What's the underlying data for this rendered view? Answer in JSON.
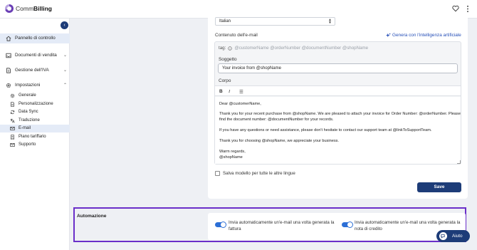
{
  "app": {
    "name_light": "Comm",
    "name_bold": "Billing"
  },
  "sidebar": {
    "collapse_glyph": "‹",
    "items": [
      {
        "label": "Pannello di controllo",
        "icon": "home-icon",
        "active": true
      },
      {
        "label": "Documenti di vendita",
        "icon": "inbox-icon"
      },
      {
        "label": "Gestione dell'IVA",
        "icon": "document-icon"
      },
      {
        "label": "Impostazioni",
        "icon": "gear-icon"
      }
    ],
    "sub_items": [
      {
        "label": "Generale",
        "icon": "gear-icon"
      },
      {
        "label": "Personalizzazione",
        "icon": "document-icon"
      },
      {
        "label": "Data Sync",
        "icon": "sync-icon"
      },
      {
        "label": "Traduzione",
        "icon": "translate-icon"
      },
      {
        "label": "E-mail",
        "icon": "mail-icon",
        "active": true
      },
      {
        "label": "Piano tariffario",
        "icon": "receipt-icon"
      },
      {
        "label": "Supporto",
        "icon": "mail-icon"
      }
    ]
  },
  "form": {
    "language_value": "Italian",
    "email_content_label": "Contenuto dell'e-mail",
    "ai_link": "Genera con l'intelligenza artificiale",
    "tags_label": "tag:",
    "tags": "@customerName @orderNumber @documentNumber @shopName",
    "subject_label": "Soggetto",
    "subject_value": "Your invoice from @shopName",
    "body_label": "Corpo",
    "toolbar": {
      "bold": "B",
      "italic": "I",
      "list": "☰"
    },
    "body_lines": [
      "Dear @customerName,",
      "Thank you for your recent purchase from @shopName. We are pleased to attach your invoice for Order Number: @orderNumber. Please",
      "find the document number: @documentNumber for your records.",
      "If you have any questions or need assistance, please don't hesitate to contact our support team at @linkToSupportTeam.",
      "Thank you for choosing @shopName, we appreciate your business.",
      "Warm regards,",
      "@shopName"
    ],
    "save_template_label": "Salva modello per tutte le altre lingue",
    "save_template_checked": false,
    "save_button": "Save"
  },
  "automation": {
    "title": "Automazione",
    "toggles": [
      {
        "label": "Invia automaticamente un'e-mail una volta generata la fattura",
        "on": true
      },
      {
        "label": "Invia automaticamente un'e-mail una volta generata la nota di credito",
        "on": true
      }
    ]
  },
  "help": {
    "label": "Aiuto"
  },
  "colors": {
    "primary": "#1d3c78",
    "accent": "#6a2fc9",
    "link": "#2750b8",
    "toggle": "#2c6fd6"
  }
}
